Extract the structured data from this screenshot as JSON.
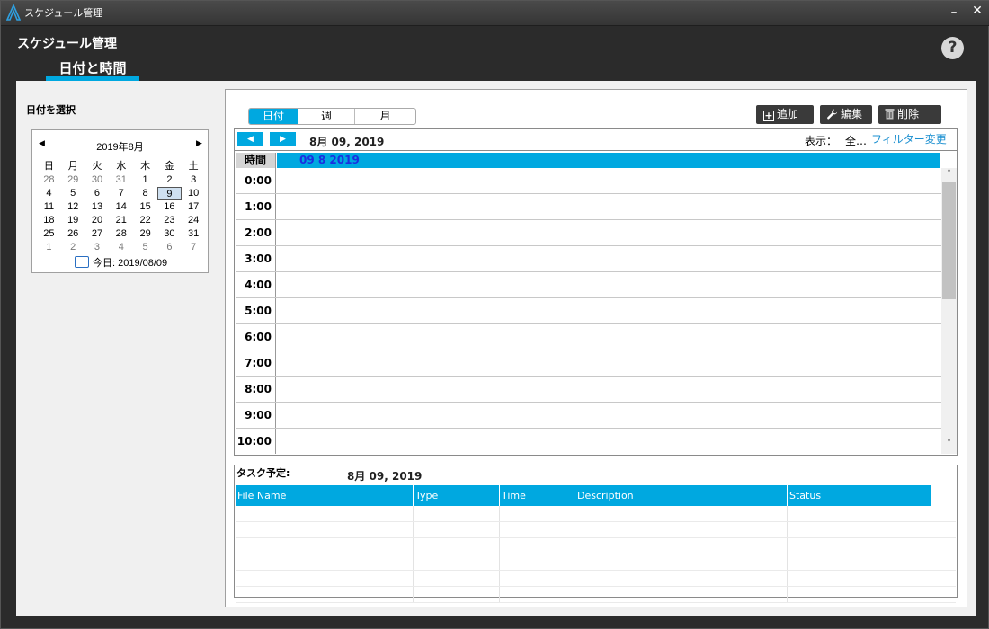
{
  "window": {
    "title": "スケジュール管理",
    "minimize_label": "–",
    "close_label": "✕"
  },
  "page": {
    "heading": "スケジュール管理",
    "help_label": "?",
    "tab_label": "日付と時間"
  },
  "date_picker": {
    "section_label": "日付を選択",
    "month_label": "2019年8月",
    "prev_label": "◀",
    "next_label": "▶",
    "weekdays": [
      "日",
      "月",
      "火",
      "水",
      "木",
      "金",
      "土"
    ],
    "weeks": [
      [
        "28",
        "29",
        "30",
        "31",
        "1",
        "2",
        "3"
      ],
      [
        "4",
        "5",
        "6",
        "7",
        "8",
        "9",
        "10"
      ],
      [
        "11",
        "12",
        "13",
        "14",
        "15",
        "16",
        "17"
      ],
      [
        "18",
        "19",
        "20",
        "21",
        "22",
        "23",
        "24"
      ],
      [
        "25",
        "26",
        "27",
        "28",
        "29",
        "30",
        "31"
      ],
      [
        "1",
        "2",
        "3",
        "4",
        "5",
        "6",
        "7"
      ]
    ],
    "selected_day": "9",
    "today_label": "今日: 2019/08/09"
  },
  "toolbar": {
    "views": [
      "日付",
      "週",
      "月"
    ],
    "active_view": "日付",
    "add_label": "追加",
    "edit_label": "編集",
    "delete_label": "削除"
  },
  "schedule": {
    "prev_label": "◀",
    "next_label": "▶",
    "current_date": "8月 09, 2019",
    "display_label": "表示：",
    "display_value": "全…",
    "filter_link": "フィルター変更",
    "time_header": "時間",
    "day_header": "09 8 2019",
    "hours": [
      "0:00",
      "1:00",
      "2:00",
      "3:00",
      "4:00",
      "5:00",
      "6:00",
      "7:00",
      "8:00",
      "9:00",
      "10:00"
    ],
    "scroll_up": "˄",
    "scroll_down": "˅"
  },
  "tasks": {
    "label": "タスク予定:",
    "date": "8月 09, 2019",
    "columns": [
      "File Name",
      "Type",
      "Time",
      "Description",
      "Status"
    ],
    "rows": []
  },
  "colors": {
    "accent": "#00a8e0",
    "dark_bg": "#2b2b2b",
    "panel_bg": "#f0f0f0",
    "button_dark": "#3a3a3a",
    "link": "#1a8fd0",
    "day_header_text": "#1a2fe0"
  },
  "icons": {
    "app": "app-logo-icon",
    "add": "plus-square-icon",
    "edit": "wrench-icon",
    "delete": "trash-icon",
    "help": "question-mark-icon"
  }
}
